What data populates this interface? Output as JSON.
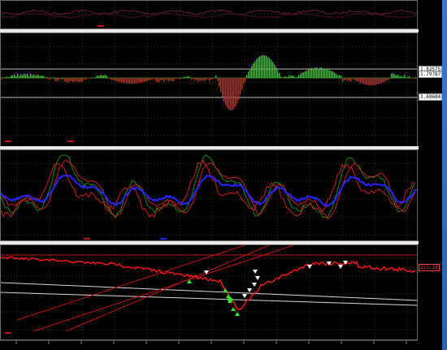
{
  "indicator_panel": {
    "levels": [
      {
        "label": "1.82575",
        "kind": "upper",
        "color": "#ffffff"
      },
      {
        "label": "1.79787",
        "kind": "current",
        "color": "#ffffff"
      },
      {
        "label": "3.69684",
        "kind": "lower",
        "color": "#ffffff"
      }
    ]
  },
  "price_panel": {
    "current_price_label": "223.19",
    "tag_color": "#ff2a2a"
  },
  "colors": {
    "background": "#000000",
    "grid": "#3a3a3a",
    "hist_up": "#22d322",
    "hist_down": "#e0241b",
    "osc_red": "#cc1f1f",
    "osc_green": "#138a13",
    "osc_blue": "#2626ff",
    "price": "#ff1a1a",
    "channel": "#c21515",
    "trend_white": "#d8d8d8",
    "arrow_up": "#38e238",
    "arrow_down": "#ffffff"
  }
}
